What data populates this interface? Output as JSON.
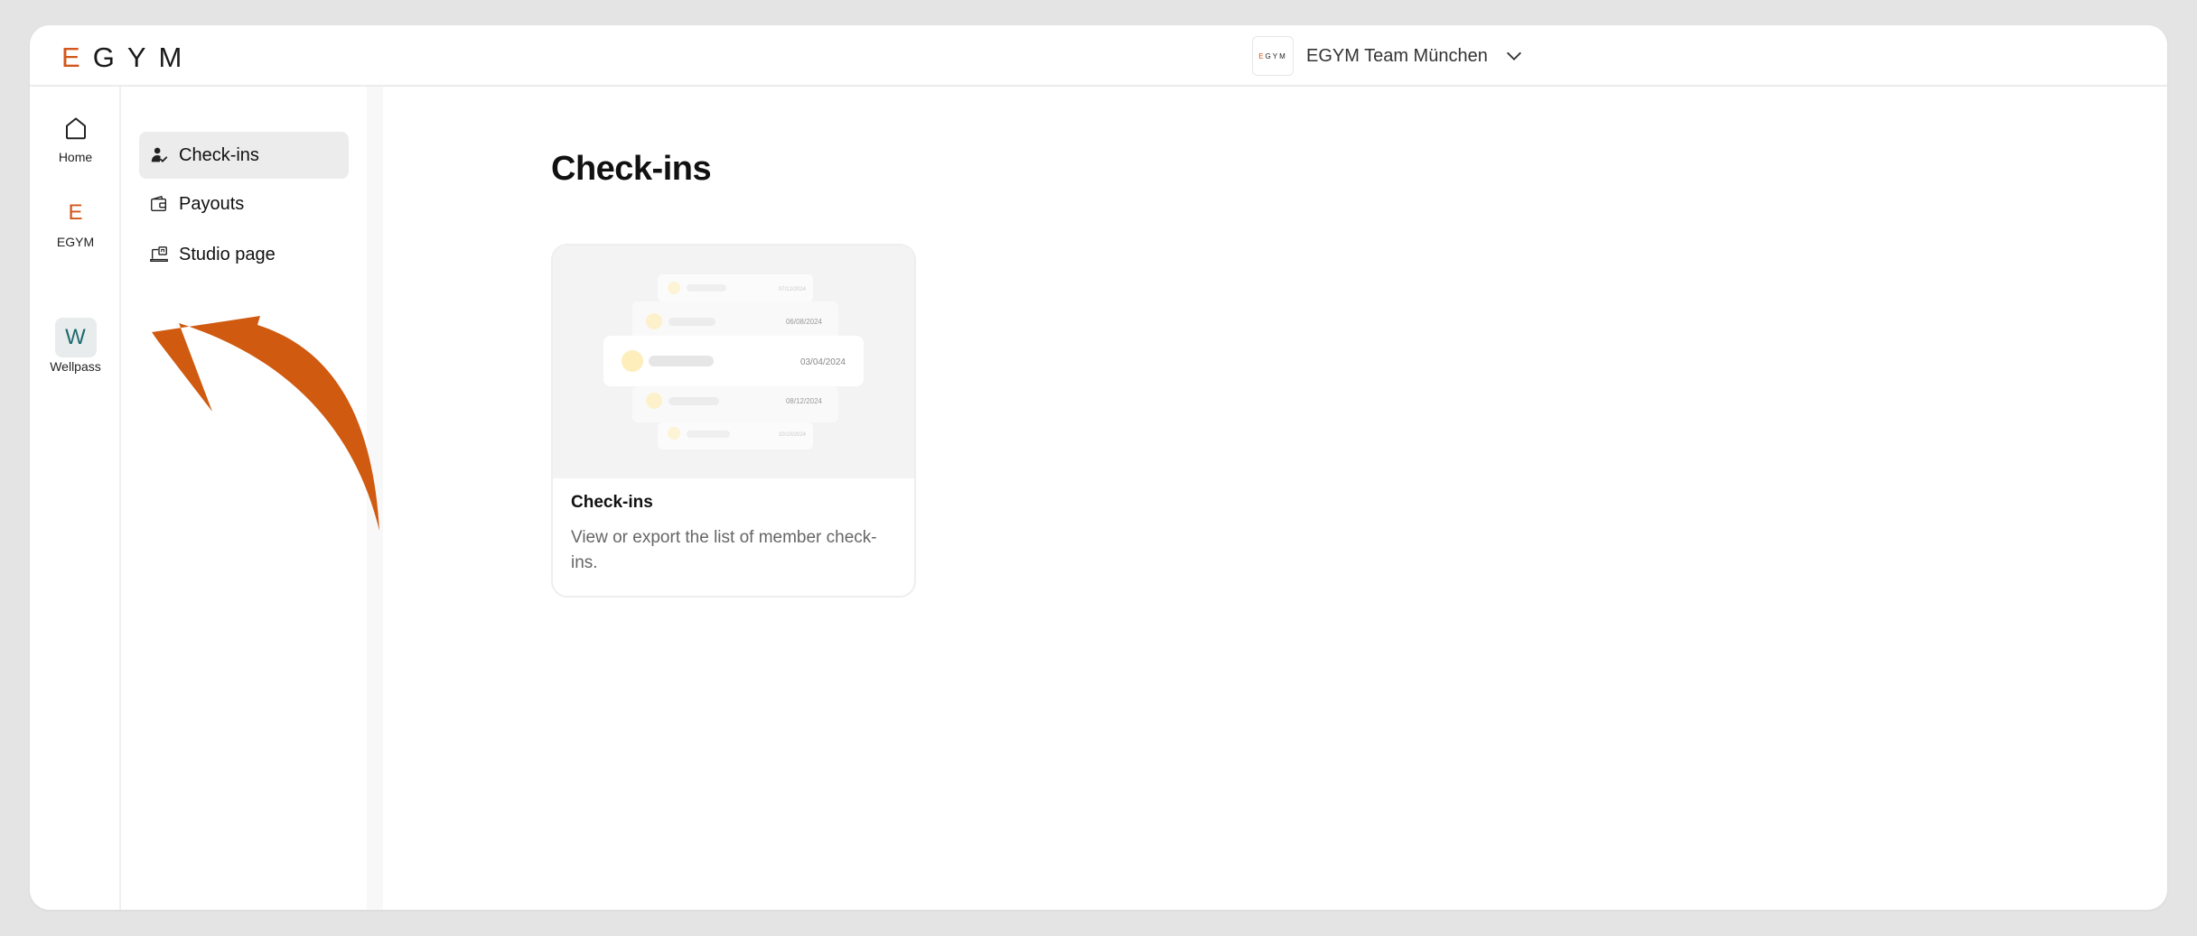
{
  "brand": {
    "logo_letters": [
      "E",
      "G",
      "Y",
      "M"
    ],
    "accent": "#d2561a",
    "wellpass_color": "#1e6a6e"
  },
  "org": {
    "logo_text": "GYM",
    "logo_accent": "E",
    "name": "EGYM Team München",
    "chevron": "chevron-down-icon"
  },
  "rail": {
    "items": [
      {
        "icon": "home-icon",
        "label": "Home"
      },
      {
        "icon_letter": "E",
        "label": "EGYM"
      },
      {
        "icon_letter": "W",
        "label": "Wellpass"
      }
    ]
  },
  "subnav": {
    "items": [
      {
        "icon": "check-in-icon",
        "label": "Check-ins",
        "active": true
      },
      {
        "icon": "wallet-icon",
        "label": "Payouts"
      },
      {
        "icon": "studio-icon",
        "label": "Studio page"
      }
    ]
  },
  "main": {
    "title": "Check-ins",
    "cards": [
      {
        "title": "Check-ins",
        "description": "View or export the list of member check-ins.",
        "illustration_dates": [
          "07/12/2024",
          "06/08/2024",
          "03/04/2024",
          "08/12/2024",
          "10/10/2024"
        ]
      }
    ]
  },
  "annotation": {
    "arrow_color": "#cf5a10"
  }
}
